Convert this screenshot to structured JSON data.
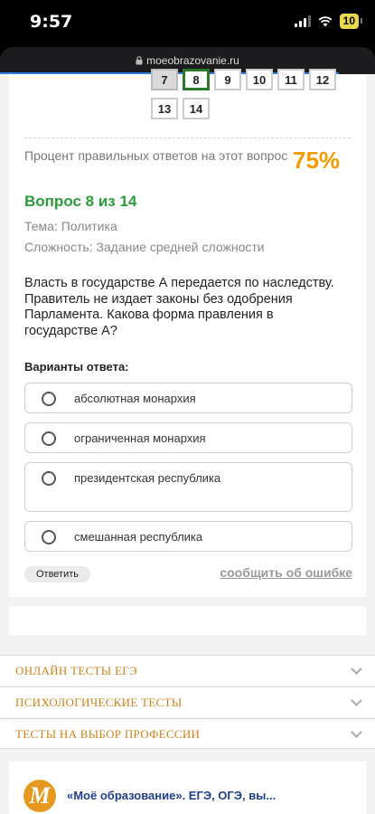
{
  "status": {
    "time": "9:57",
    "battery": "10"
  },
  "browser": {
    "url": "moeobrazovanie.ru"
  },
  "pagination": {
    "row1": [
      {
        "label": "7",
        "state": "done"
      },
      {
        "label": "8",
        "state": "current"
      },
      {
        "label": "9",
        "state": "open"
      },
      {
        "label": "10",
        "state": "open"
      },
      {
        "label": "11",
        "state": "open"
      },
      {
        "label": "12",
        "state": "open"
      }
    ],
    "row2": [
      {
        "label": "13",
        "state": "open"
      },
      {
        "label": "14",
        "state": "open"
      }
    ]
  },
  "stats": {
    "label": "Процент правильных ответов на этот вопрос",
    "value": "75%"
  },
  "question": {
    "title": "Вопрос 8 из 14",
    "topic": "Тема: Политика",
    "difficulty": "Сложность: Задание средней сложности",
    "text": "Власть в государстве А передается по наследству. Правитель не издает законы без одобрения Парламента. Какова форма правления в государстве А?",
    "answers_heading": "Варианты ответа:",
    "options": [
      "абсолютная монархия",
      "ограниченная монархия",
      "президентская республика",
      "смешанная республика"
    ],
    "answer_button": "Ответить",
    "report_link": "сообщить об ошибке"
  },
  "accordion": [
    "ОНЛАЙН ТЕСТЫ ЕГЭ",
    "ПСИХОЛОГИЧЕСКИЕ ТЕСТЫ",
    "ТЕСТЫ НА ВЫБОР ПРОФЕССИИ"
  ],
  "footer": {
    "logo_letter": "М",
    "title": "«Моё образование». ЕГЭ, ОГЭ, вы..."
  },
  "colors": {
    "green": "#2a9d3a",
    "orange": "#f39c00",
    "accordion_text": "#c8831a",
    "link_blue": "#2f7de1"
  }
}
